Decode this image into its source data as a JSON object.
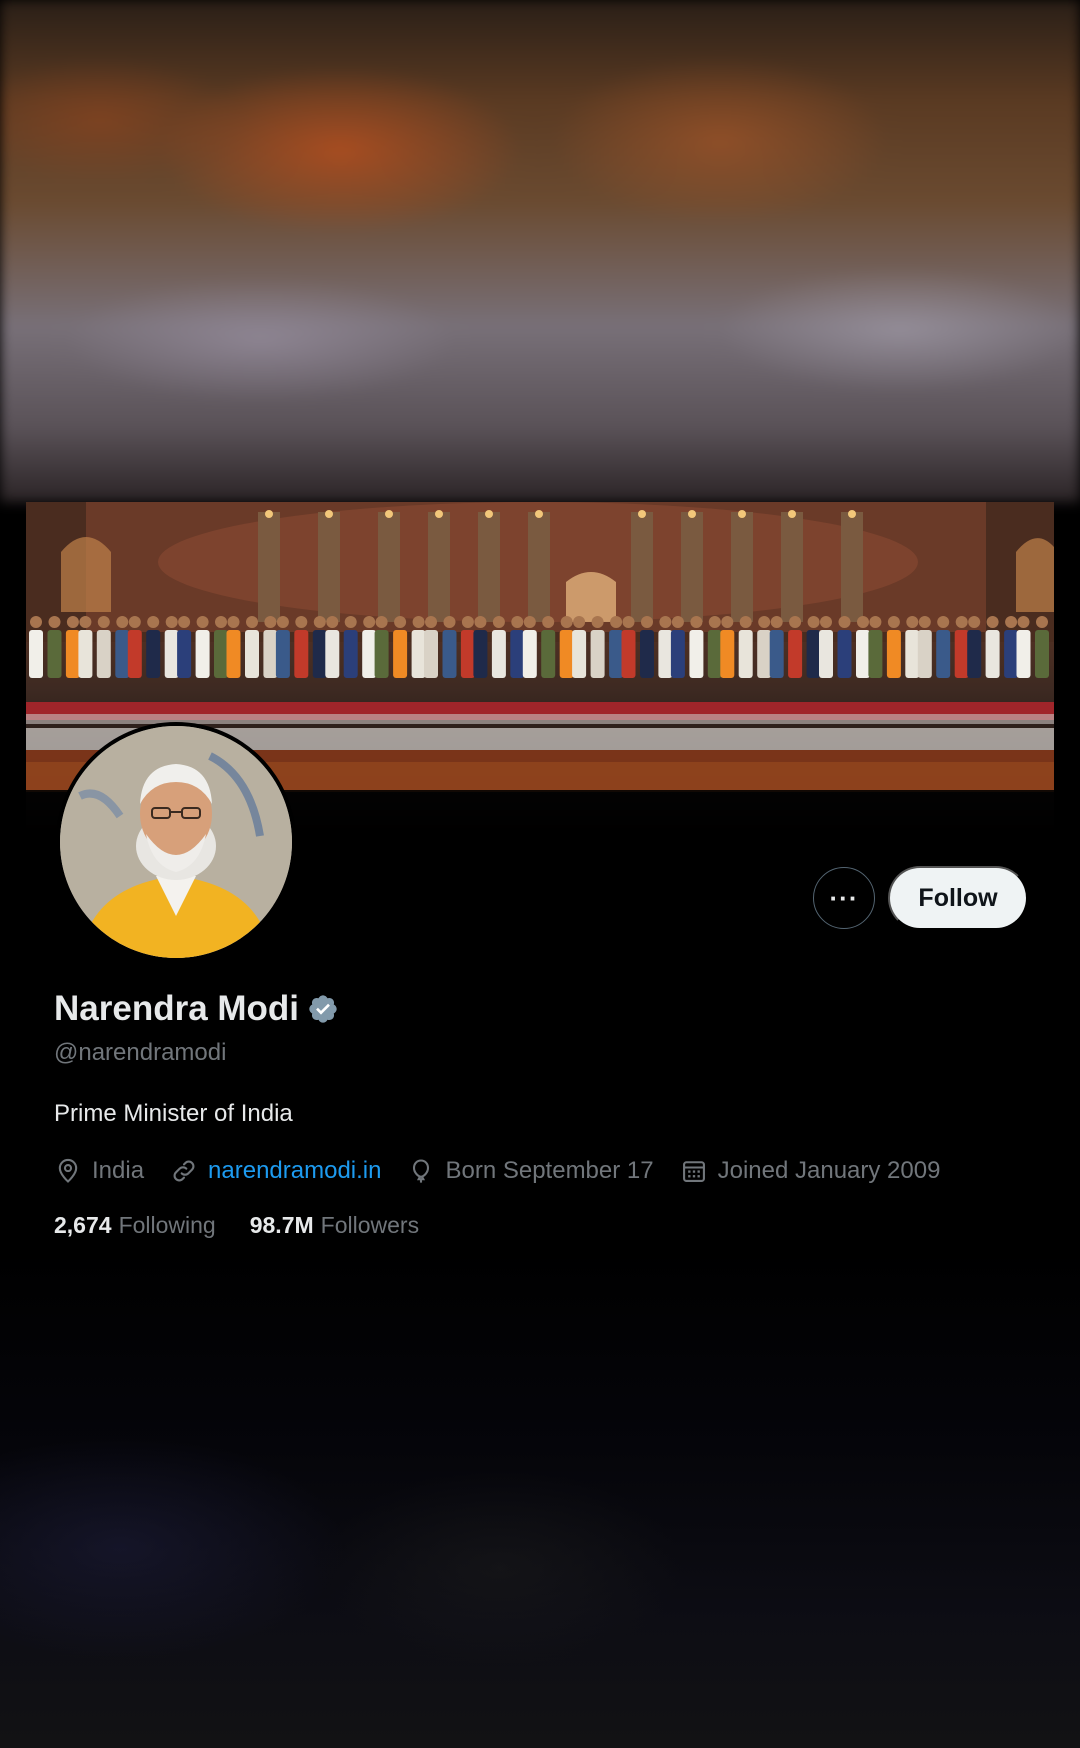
{
  "profile": {
    "display_name": "Narendra Modi",
    "handle": "@narendramodi",
    "bio": "Prime Minister of India",
    "location": "India",
    "website": "narendramodi.in",
    "birthday": "Born September 17",
    "joined": "Joined January 2009",
    "verified_color": "#829aab"
  },
  "stats": {
    "following_count": "2,674",
    "following_label": "Following",
    "followers_count": "98.7M",
    "followers_label": "Followers"
  },
  "actions": {
    "more_label": "···",
    "follow_label": "Follow"
  },
  "icons": {
    "location": "location-pin-icon",
    "website": "link-icon",
    "birthday": "balloon-icon",
    "joined": "calendar-icon",
    "verified": "verified-badge-icon"
  },
  "theme": {
    "background": "#000000",
    "text_primary": "#e7e9ea",
    "text_secondary": "#71767b",
    "link": "#1d9bf0",
    "button_light": "#eff3f4"
  }
}
